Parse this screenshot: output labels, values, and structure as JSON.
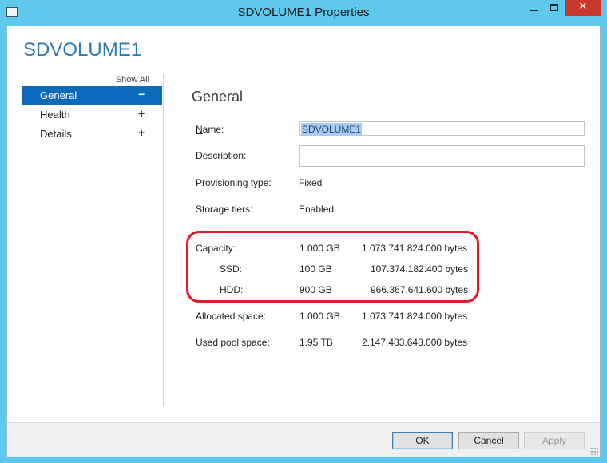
{
  "window": {
    "title": "SDVOLUME1 Properties",
    "controls": {
      "minimize": "",
      "maximize": "",
      "close": "✕"
    }
  },
  "header": {
    "title": "SDVOLUME1"
  },
  "nav": {
    "show_all": "Show All",
    "items": [
      {
        "label": "General",
        "symbol": "−",
        "active": true
      },
      {
        "label": "Health",
        "symbol": "+",
        "active": false
      },
      {
        "label": "Details",
        "symbol": "+",
        "active": false
      }
    ]
  },
  "general": {
    "title": "General",
    "name": {
      "label_pre": "",
      "label_u": "N",
      "label_post": "ame:",
      "value": "SDVOLUME1"
    },
    "description": {
      "label_pre": "",
      "label_u": "D",
      "label_post": "escription:",
      "value": ""
    },
    "provisioning": {
      "label": "Provisioning type:",
      "value": "Fixed"
    },
    "storage_tiers": {
      "label": "Storage tiers:",
      "value": "Enabled"
    },
    "capacity": {
      "label": "Capacity:",
      "size": "1.000 GB",
      "bytes": "1.073.741.824.000 bytes"
    },
    "ssd": {
      "label": "SSD:",
      "size": "100 GB",
      "bytes": "107.374.182.400 bytes"
    },
    "hdd": {
      "label": "HDD:",
      "size": "900 GB",
      "bytes": "966.367.641.600 bytes"
    },
    "allocated": {
      "label": "Allocated space:",
      "size": "1.000 GB",
      "bytes": "1.073.741.824.000 bytes"
    },
    "used_pool": {
      "label": "Used pool space:",
      "size": "1,95 TB",
      "bytes": "2.147.483.648.000 bytes"
    }
  },
  "footer": {
    "ok": "OK",
    "cancel": "Cancel",
    "apply": "Apply"
  },
  "colors": {
    "titlebar": "#5ec9ec",
    "accent": "#0a6bbd",
    "highlight": "#e01a2a"
  }
}
